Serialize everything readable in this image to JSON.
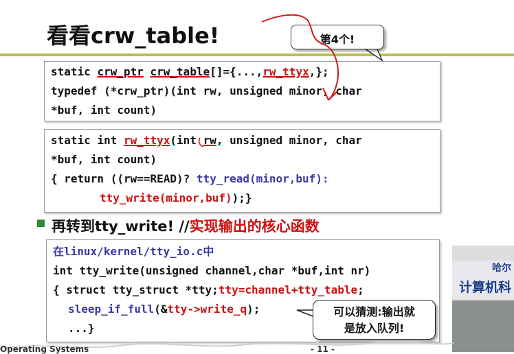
{
  "slide": {
    "title": "看看crw_table!",
    "callout_top": "第4个!",
    "box1": {
      "line1_a": "static ",
      "line1_b": "crw_ptr",
      "line1_c": " ",
      "line1_d": "crw_table",
      "line1_e": "[]={...,",
      "line1_f": "rw_ttyx",
      "line1_g": ",};",
      "line2": "typedef (*crw_ptr)(int rw, unsigned minor, char",
      "line3": "*buf, int count)"
    },
    "box2": {
      "line1_a": "static int ",
      "line1_b": "rw_ttyx",
      "line1_c": "(int ",
      "line1_d": "rw",
      "line1_e": ", unsigned minor, char",
      "line2": "*buf, int count)",
      "line3_a": "{ return ((rw==READ)? ",
      "line3_b": "tty_read(minor,buf):",
      "line4_a": "tty_write(minor,buf)",
      "line4_b": ");}"
    },
    "bullet": {
      "black_a": "再转到",
      "black_b": "tty_write! //",
      "red": "实现输出的核心函数"
    },
    "box3": {
      "line1_a": "在",
      "line1_b": "linux/kernel/tty_io.c",
      "line1_c": "中",
      "line2": "int tty_write(unsigned channel,char *buf,int nr)",
      "line3_a": "{ struct tty_struct *tty;",
      "line3_b": "tty=channel+tty_table",
      "line3_c": ";",
      "line4_a": "sleep_if_full",
      "line4_b": "(&",
      "line4_c": "tty->write_q",
      "line4_d": ");",
      "line5": "...}"
    },
    "callout_bottom": {
      "line1": "可以猜测:输出就",
      "line2": "是放入队列!"
    },
    "photo": {
      "sign_top": "哈尔",
      "sign_main": "计算机科"
    },
    "footer": {
      "course": "Operating Systems",
      "page": "- 11 -"
    }
  }
}
